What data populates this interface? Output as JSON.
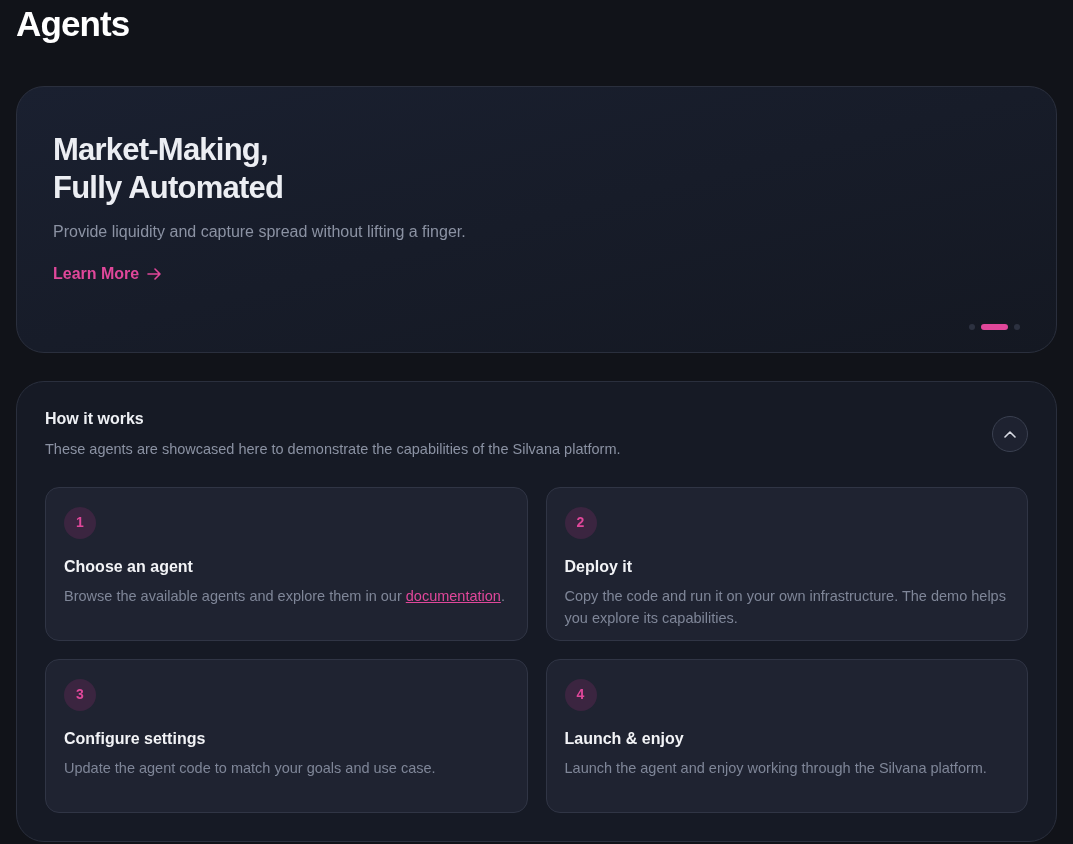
{
  "page_title": "Agents",
  "hero": {
    "title_lines": [
      "Market-Making,",
      "Fully Automated"
    ],
    "subtitle": "Provide liquidity and capture spread without lifting a finger.",
    "link": "Learn More",
    "slides": [
      {
        "selected": false
      },
      {
        "selected": true
      },
      {
        "selected": false
      }
    ]
  },
  "how_it_works": {
    "title": "How it works",
    "subtitle": "These agents are showcased here to demonstrate the capabilities of the Silvana platform.",
    "expanded": true,
    "steps": [
      {
        "number": "1",
        "title": "Choose an agent",
        "description": "Browse the available agents and explore them in our",
        "link": "documentation",
        "after_link": "."
      },
      {
        "number": "2",
        "title": "Deploy it",
        "description": "Copy the code and run it on your own infrastructure. The demo helps you explore its capabilities."
      },
      {
        "number": "3",
        "title": "Configure settings",
        "description": "Update the agent code to match your goals and use case."
      },
      {
        "number": "4",
        "title": "Launch & enjoy",
        "description": "Launch the agent and enjoy working through the Silvana platform."
      }
    ]
  }
}
